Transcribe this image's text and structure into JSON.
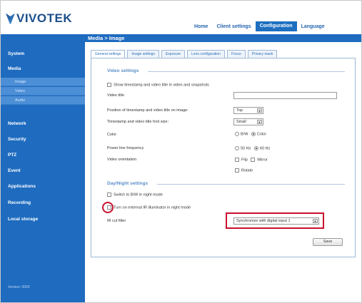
{
  "brand": {
    "logo_text": "VIVOTEK"
  },
  "topnav": [
    "Home",
    "Client settings",
    "Configuration",
    "Language"
  ],
  "topnav_active": "Configuration",
  "sidebar": {
    "items": [
      "System",
      "Media",
      "Network",
      "Security",
      "PTZ",
      "Event",
      "Applications",
      "Recording",
      "Local storage"
    ],
    "media_subitems": [
      "Image",
      "Video",
      "Audio"
    ],
    "version": "Version: 0000"
  },
  "breadcrumb": "Media > Image",
  "tabs": [
    "General settings",
    "Image settings",
    "Exposure",
    "Lens configuration",
    "Focus",
    "Privacy mask"
  ],
  "video_settings": {
    "title": "Video settings",
    "show_timestamp_label": "Show timestamp and video title in video and snapshots",
    "video_title_label": "Video title",
    "position_label": "Position of timestamp and video title on image:",
    "position_value": "Top",
    "font_size_label": "Timestamp and video title font size:",
    "font_size_value": "Small",
    "color_label": "Color",
    "color_options": [
      "B/W",
      "Color"
    ],
    "power_label": "Power line frequency",
    "power_options": [
      "50 Hz",
      "60 Hz"
    ],
    "orientation_label": "Video orientation",
    "orientation_options": [
      "Flip",
      "Mirror",
      "Rotate"
    ]
  },
  "daynight": {
    "title": "Day/Night settings",
    "switch_bw_label": "Switch to B/W in night mode",
    "ir_illuminator_label": "Turn on external IR illuminator in night mode",
    "ir_cut_label": "IR cut filter",
    "ir_cut_value": "Synchronize with digital input 1"
  },
  "save_label": "Save",
  "colors": {
    "accent": "#1e6bc0",
    "highlight": "#c8102e"
  }
}
